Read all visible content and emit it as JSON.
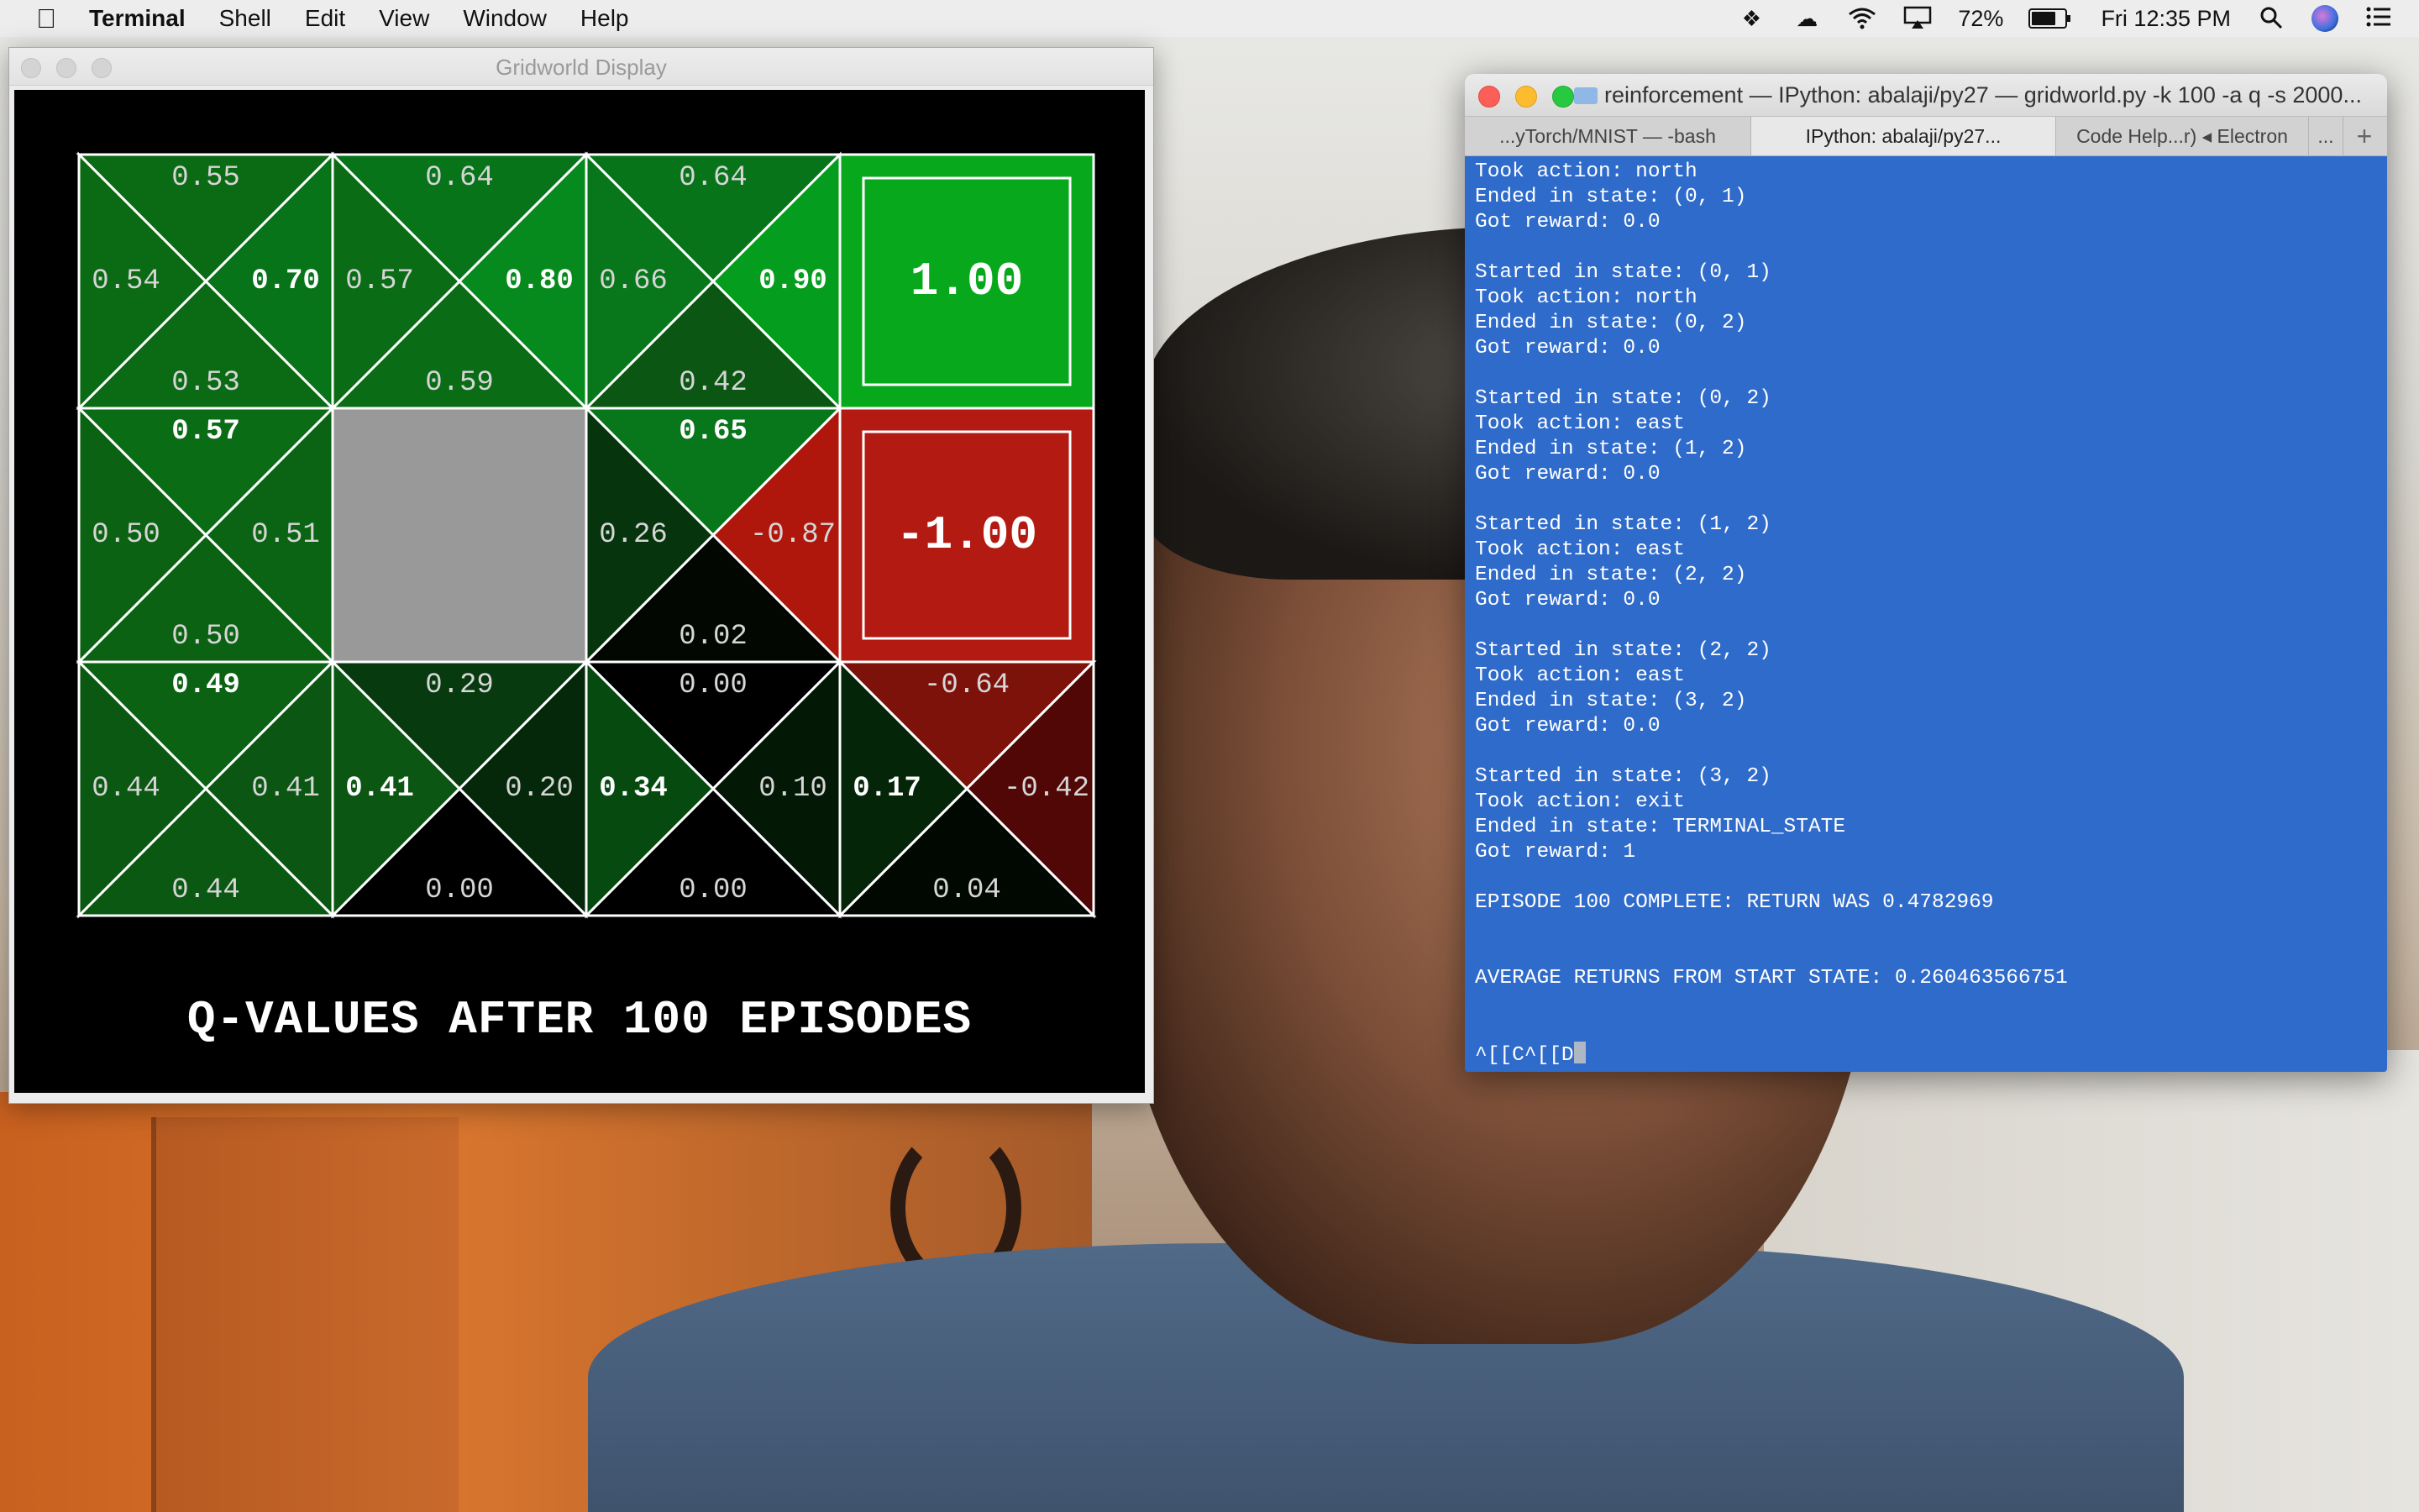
{
  "menubar": {
    "app_name": "Terminal",
    "menus": [
      "Shell",
      "Edit",
      "View",
      "Window",
      "Help"
    ],
    "battery_percent": "72%",
    "battery_level": 0.72,
    "clock": "Fri 12:35 PM",
    "status_icons": [
      "dropbox-icon",
      "cloud-upload-icon",
      "wifi-icon",
      "airplay-icon",
      "battery-icon",
      "spotlight-search-icon",
      "siri-icon",
      "notification-center-icon"
    ]
  },
  "gridworld": {
    "window_title": "Gridworld Display",
    "caption": "Q-VALUES AFTER 100 EPISODES",
    "cells": [
      {
        "row": 0,
        "col": 0,
        "type": "q",
        "n": "0.55",
        "w": "0.54",
        "e": "0.70",
        "s": "0.53",
        "nc": "#0b6a14",
        "wc": "#0b6a14",
        "ec": "#07741a",
        "sc": "#0b6a14",
        "bold": "e"
      },
      {
        "row": 0,
        "col": 1,
        "type": "q",
        "n": "0.64",
        "w": "0.57",
        "e": "0.80",
        "s": "0.59",
        "nc": "#08741a",
        "wc": "#0b6c16",
        "ec": "#078a1d",
        "sc": "#0b6c16",
        "bold": "e"
      },
      {
        "row": 0,
        "col": 2,
        "type": "q",
        "n": "0.64",
        "w": "0.66",
        "e": "0.90",
        "s": "0.42",
        "nc": "#08741a",
        "wc": "#08761a",
        "ec": "#049d1d",
        "sc": "#0b5612",
        "bold": "e"
      },
      {
        "row": 0,
        "col": 3,
        "type": "terminal",
        "value": "1.00",
        "color": "#08a81c"
      },
      {
        "row": 1,
        "col": 0,
        "type": "q",
        "n": "0.57",
        "w": "0.50",
        "e": "0.51",
        "s": "0.50",
        "nc": "#0b6c16",
        "wc": "#0b6212",
        "ec": "#0b6414",
        "sc": "#0b6212",
        "bold": "n"
      },
      {
        "row": 1,
        "col": 1,
        "type": "wall",
        "color": "#999999"
      },
      {
        "row": 1,
        "col": 2,
        "type": "q",
        "n": "0.65",
        "w": "0.26",
        "e": "-0.87",
        "s": "0.02",
        "nc": "#08761a",
        "wc": "#06340c",
        "ec": "#b0170c",
        "sc": "#020702",
        "bold": "n"
      },
      {
        "row": 1,
        "col": 3,
        "type": "terminal",
        "value": "-1.00",
        "color": "#b31a12"
      },
      {
        "row": 2,
        "col": 0,
        "type": "q",
        "n": "0.49",
        "w": "0.44",
        "e": "0.41",
        "s": "0.44",
        "nc": "#0b6212",
        "wc": "#0b5813",
        "ec": "#0b5612",
        "sc": "#0b5813",
        "bold": "n"
      },
      {
        "row": 2,
        "col": 1,
        "type": "q",
        "n": "0.29",
        "w": "0.41",
        "e": "0.20",
        "s": "0.00",
        "nc": "#073a0e",
        "wc": "#0b5612",
        "ec": "#05280a",
        "sc": "#000000",
        "bold": "w"
      },
      {
        "row": 2,
        "col": 2,
        "type": "q",
        "n": "0.00",
        "w": "0.34",
        "e": "0.10",
        "s": "0.00",
        "nc": "#000000",
        "wc": "#074a0f",
        "ec": "#031805",
        "sc": "#000000",
        "bold": "w"
      },
      {
        "row": 2,
        "col": 3,
        "type": "q",
        "n": "-0.64",
        "w": "0.17",
        "e": "-0.42",
        "s": "0.04",
        "nc": "#7d120b",
        "wc": "#052509",
        "ec": "#520707",
        "sc": "#010801",
        "bold": "w"
      }
    ]
  },
  "terminal": {
    "window_title": "reinforcement — IPython: abalaji/py27 — gridworld.py -k 100 -a q -s 2000...",
    "tabs": [
      "...yTorch/MNIST — -bash",
      "IPython: abalaji/py27...",
      "Code Help...r) ◂ Electron",
      "..."
    ],
    "active_tab": 1,
    "new_tab": "+",
    "lines": [
      "Took action: north",
      "Ended in state: (0, 1)",
      "Got reward: 0.0",
      "",
      "Started in state: (0, 1)",
      "Took action: north",
      "Ended in state: (0, 2)",
      "Got reward: 0.0",
      "",
      "Started in state: (0, 2)",
      "Took action: east",
      "Ended in state: (1, 2)",
      "Got reward: 0.0",
      "",
      "Started in state: (1, 2)",
      "Took action: east",
      "Ended in state: (2, 2)",
      "Got reward: 0.0",
      "",
      "Started in state: (2, 2)",
      "Took action: east",
      "Ended in state: (3, 2)",
      "Got reward: 0.0",
      "",
      "Started in state: (3, 2)",
      "Took action: exit",
      "Ended in state: TERMINAL_STATE",
      "Got reward: 1",
      "",
      "EPISODE 100 COMPLETE: RETURN WAS 0.4782969",
      "",
      "",
      "AVERAGE RETURNS FROM START STATE: 0.260463566751",
      "",
      "",
      "^[[C^[[D"
    ]
  }
}
